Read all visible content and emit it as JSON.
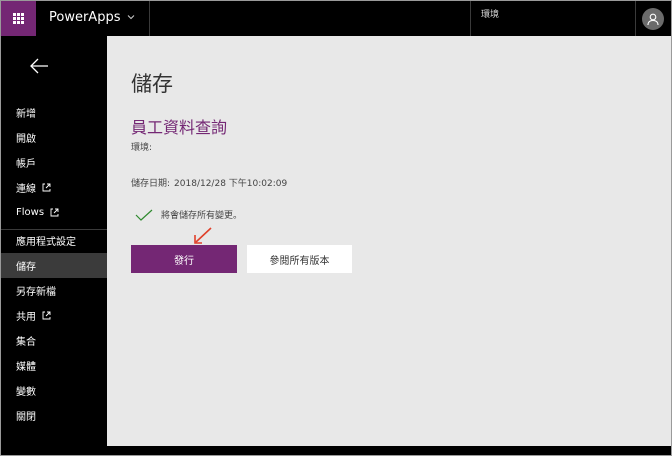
{
  "topbar": {
    "app_name": "PowerApps",
    "environment_label": "環境",
    "icons": {
      "waffle": "waffle-icon",
      "chevron": "chevron-down-icon",
      "avatar": "user-avatar-icon"
    },
    "accent_color": "#742774"
  },
  "sidebar": {
    "back_icon": "back-arrow-icon",
    "items": [
      {
        "label": "新增",
        "external": false,
        "active": false
      },
      {
        "label": "開啟",
        "external": false,
        "active": false
      },
      {
        "label": "帳戶",
        "external": false,
        "active": false
      },
      {
        "label": "連線",
        "external": true,
        "active": false
      },
      {
        "label": "Flows",
        "external": true,
        "active": false
      },
      {
        "label": "應用程式設定",
        "external": false,
        "active": false
      },
      {
        "label": "儲存",
        "external": false,
        "active": true
      },
      {
        "label": "另存新檔",
        "external": false,
        "active": false
      },
      {
        "label": "共用",
        "external": true,
        "active": false
      },
      {
        "label": "集合",
        "external": false,
        "active": false
      },
      {
        "label": "媒體",
        "external": false,
        "active": false
      },
      {
        "label": "變數",
        "external": false,
        "active": false
      },
      {
        "label": "關閉",
        "external": false,
        "active": false
      }
    ]
  },
  "main": {
    "page_title": "儲存",
    "app_title": "員工資料查詢",
    "environment_label": "環境:",
    "save_date_label": "儲存日期:",
    "save_date_value": "2018/12/28 下午10:02:09",
    "status_message": "將會儲存所有變更。",
    "publish_button": "發行",
    "versions_button": "參閱所有版本"
  }
}
